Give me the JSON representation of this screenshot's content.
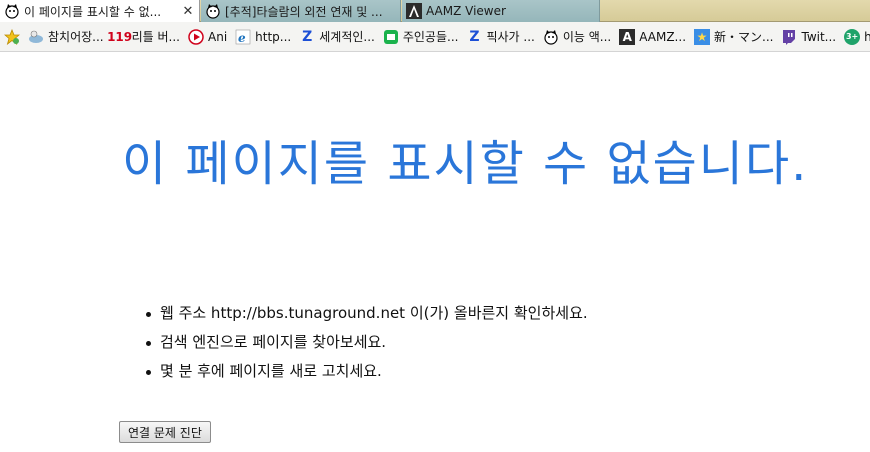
{
  "tabs": [
    {
      "label": "이 페이지를 표시할 수 없... ",
      "icon": "cat-face-icon",
      "close": "✕"
    },
    {
      "label": "[추적]타슬람의 외전 연재 및 ...",
      "icon": "cat-face-icon"
    },
    {
      "label": "AAMZ Viewer",
      "icon": "aamz-logo-icon"
    }
  ],
  "bookmarks": [
    {
      "label": "참치어장...",
      "icon": "tuna-icon"
    },
    {
      "label": "리틀 버...",
      "icon": "119-icon",
      "glyph": "119"
    },
    {
      "label": "Ani",
      "icon": "play-icon"
    },
    {
      "label": "http...",
      "icon": "ie-icon"
    },
    {
      "label": "세계적인...",
      "icon": "z-icon",
      "glyph": "Z"
    },
    {
      "label": "주인공들...",
      "icon": "green-box-icon"
    },
    {
      "label": "픽사가 ...",
      "icon": "z-icon",
      "glyph": "Z"
    },
    {
      "label": "이능 액...",
      "icon": "cat-face-icon"
    },
    {
      "label": "AAMZ...",
      "icon": "aamz-logo-icon",
      "glyph": "A"
    },
    {
      "label": "新・マン...",
      "icon": "star-icon",
      "glyph": "★"
    },
    {
      "label": "Twit...",
      "icon": "twitch-icon"
    },
    {
      "label": "http",
      "icon": "green-circle-icon",
      "glyph": "3+"
    }
  ],
  "page": {
    "title": "이 페이지를 표시할 수 없습니다.",
    "suggestions": [
      "웹 주소 http://bbs.tunaground.net 이(가) 올바른지 확인하세요.",
      "검색 엔진으로 페이지를 찾아보세요.",
      "몇 분 후에 페이지를 새로 고치세요."
    ],
    "diagnose_button": "연결 문제 진단"
  },
  "colors": {
    "title": "#2a76d9",
    "tab_strip": "#dcd2a2",
    "inactive_tab": "#a0bfc2"
  }
}
